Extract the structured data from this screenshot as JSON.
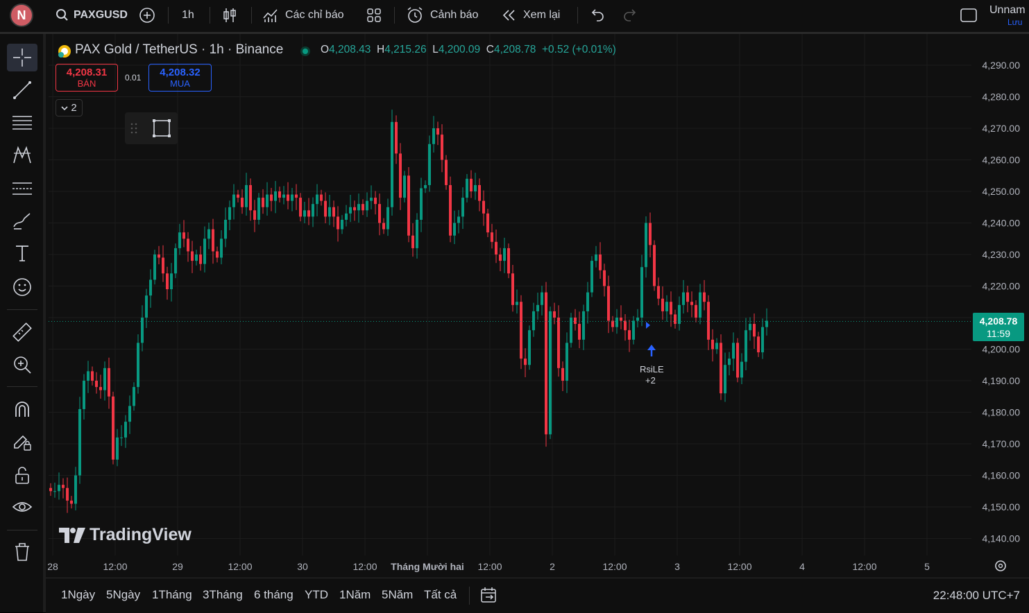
{
  "topbar": {
    "avatar_letter": "N",
    "symbol": "PAXGUSD",
    "interval": "1h",
    "indicators": "Các chỉ báo",
    "alerts": "Cảnh báo",
    "replay": "Xem lại",
    "layout_name": "Unnam",
    "save_label": "Lưu"
  },
  "legend": {
    "title": "PAX Gold / TetherUS · 1h · Binance",
    "o_key": "O",
    "o_val": "4,208.43",
    "h_key": "H",
    "h_val": "4,215.26",
    "l_key": "L",
    "l_val": "4,200.09",
    "c_key": "C",
    "c_val": "4,208.78",
    "change": "+0.52 (+0.01%)",
    "sell_price": "4,208.31",
    "sell_label": "BÁN",
    "spread": "0.01",
    "buy_price": "4,208.32",
    "buy_label": "MUA",
    "indicator_count": "2"
  },
  "signal": {
    "label": "RsiLE",
    "extra": "+2"
  },
  "watermark": "TradingView",
  "last_price": {
    "price": "4,208.78",
    "countdown": "11:59"
  },
  "price_axis": [
    "4,290.00",
    "4,280.00",
    "4,270.00",
    "4,260.00",
    "4,250.00",
    "4,240.00",
    "4,230.00",
    "4,220.00",
    "4,210.00",
    "4,200.00",
    "4,190.00",
    "4,180.00",
    "4,170.00",
    "4,160.00",
    "4,150.00",
    "4,140.00"
  ],
  "time_axis": [
    "28",
    "12:00",
    "29",
    "12:00",
    "30",
    "12:00",
    "Tháng Mười hai",
    "12:00",
    "2",
    "12:00",
    "3",
    "12:00",
    "4",
    "12:00",
    "5"
  ],
  "ranges": [
    "1Ngày",
    "5Ngày",
    "1Tháng",
    "3Tháng",
    "6 tháng",
    "YTD",
    "1Năm",
    "5Năm",
    "Tất cả"
  ],
  "timezone": "22:48:00 UTC+7",
  "colors": {
    "up": "#089981",
    "down": "#f23645",
    "accent": "#2962ff"
  },
  "chart_data": {
    "type": "candlestick",
    "symbol": "PAXGUSD",
    "interval": "1h",
    "ylim": [
      4135,
      4295
    ],
    "last_close": 4208.78,
    "closes": [
      4155,
      4155,
      4157,
      4156,
      4152,
      4151,
      4160,
      4181,
      4190,
      4193,
      4190,
      4188,
      4187,
      4194,
      4185,
      4165,
      4172,
      4172,
      4177,
      4182,
      4188,
      4202,
      4210,
      4217,
      4222,
      4230,
      4229,
      4224,
      4219,
      4224,
      4232,
      4237,
      4235,
      4231,
      4228,
      4230,
      4227,
      4235,
      4238,
      4231,
      4229,
      4235,
      4241,
      4245,
      4249,
      4248,
      4245,
      4252,
      4244,
      4241,
      4248,
      4245,
      4249,
      4247,
      4250,
      4248,
      4249,
      4247,
      4249,
      4248,
      4242,
      4244,
      4242,
      4246,
      4249,
      4247,
      4242,
      4245,
      4242,
      4238,
      4241,
      4243,
      4245,
      4244,
      4246,
      4244,
      4247,
      4248,
      4246,
      4240,
      4238,
      4245,
      4272,
      4262,
      4248,
      4255,
      4236,
      4232,
      4241,
      4251,
      4252,
      4265,
      4270,
      4268,
      4260,
      4252,
      4236,
      4240,
      4242,
      4248,
      4254,
      4250,
      4252,
      4247,
      4243,
      4237,
      4234,
      4230,
      4228,
      4232,
      4224,
      4214,
      4215,
      4197,
      4195,
      4206,
      4212,
      4214,
      4218,
      4173,
      4212,
      4210,
      4194,
      4190,
      4202,
      4210,
      4208,
      4203,
      4212,
      4218,
      4228,
      4230,
      4225,
      4220,
      4209,
      4207,
      4210,
      4209,
      4206,
      4203,
      4209,
      4210,
      4226,
      4240,
      4233,
      4220,
      4216,
      4212,
      4215,
      4211,
      4208,
      4214,
      4218,
      4215,
      4214,
      4210,
      4218,
      4215,
      4203,
      4200,
      4202,
      4186,
      4195,
      4197,
      4202,
      4191,
      4196,
      4206,
      4208,
      4204,
      4199,
      4207,
      4209
    ]
  }
}
